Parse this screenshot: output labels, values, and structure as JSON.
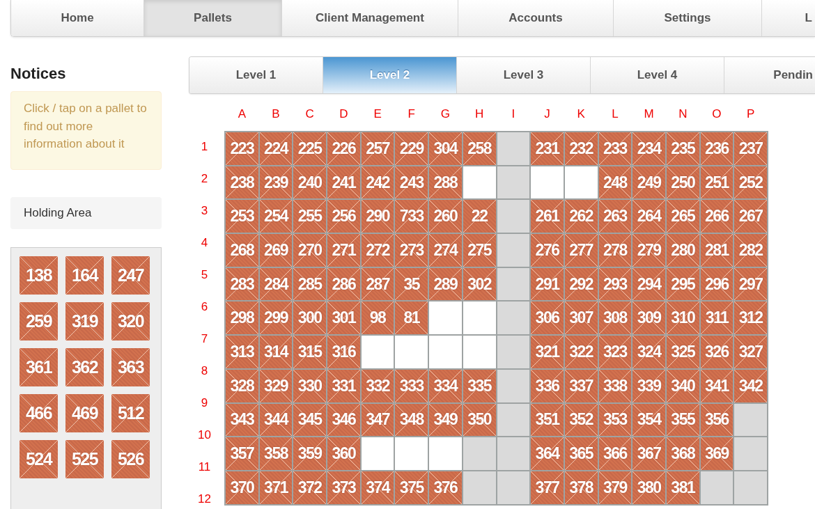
{
  "nav": [
    {
      "label": "Home",
      "selected": false
    },
    {
      "label": "Pallets",
      "selected": true
    },
    {
      "label": "Client Management",
      "selected": false
    },
    {
      "label": "Accounts",
      "selected": false
    },
    {
      "label": "Settings",
      "selected": false
    },
    {
      "label": "L",
      "selected": false
    }
  ],
  "sidebar": {
    "notices_title": "Notices",
    "notice": "Click / tap on a pallet to find out more information about it",
    "holding_area": {
      "title": "Holding Area",
      "pallets": [
        "138",
        "164",
        "247",
        "259",
        "319",
        "320",
        "361",
        "362",
        "363",
        "466",
        "469",
        "512",
        "524",
        "525",
        "526"
      ]
    }
  },
  "levels": [
    {
      "label": "Level 1",
      "selected": false
    },
    {
      "label": "Level 2",
      "selected": true
    },
    {
      "label": "Level 3",
      "selected": false
    },
    {
      "label": "Level 4",
      "selected": false
    },
    {
      "label": "Pendin",
      "selected": false
    }
  ],
  "floor": {
    "columns": [
      "A",
      "B",
      "C",
      "D",
      "E",
      "F",
      "G",
      "H",
      "I",
      "J",
      "K",
      "L",
      "M",
      "N",
      "O",
      "P"
    ],
    "row_labels": [
      "1",
      "2",
      "3",
      "4",
      "5",
      "6",
      "7",
      "8",
      "9",
      "10",
      "11",
      "12"
    ],
    "rows": [
      [
        {
          "kind": "pallet",
          "label": "223"
        },
        {
          "kind": "pallet",
          "label": "224"
        },
        {
          "kind": "pallet",
          "label": "225"
        },
        {
          "kind": "pallet",
          "label": "226"
        },
        {
          "kind": "pallet",
          "label": "257"
        },
        {
          "kind": "pallet",
          "label": "229"
        },
        {
          "kind": "pallet",
          "label": "304"
        },
        {
          "kind": "pallet",
          "label": "258"
        },
        {
          "kind": "aisle"
        },
        {
          "kind": "pallet",
          "label": "231"
        },
        {
          "kind": "pallet",
          "label": "232"
        },
        {
          "kind": "pallet",
          "label": "233"
        },
        {
          "kind": "pallet",
          "label": "234"
        },
        {
          "kind": "pallet",
          "label": "235"
        },
        {
          "kind": "pallet",
          "label": "236"
        },
        {
          "kind": "pallet",
          "label": "237"
        }
      ],
      [
        {
          "kind": "pallet",
          "label": "238"
        },
        {
          "kind": "pallet",
          "label": "239"
        },
        {
          "kind": "pallet",
          "label": "240"
        },
        {
          "kind": "pallet",
          "label": "241"
        },
        {
          "kind": "pallet",
          "label": "242"
        },
        {
          "kind": "pallet",
          "label": "243"
        },
        {
          "kind": "pallet",
          "label": "288"
        },
        {
          "kind": "empty"
        },
        {
          "kind": "aisle"
        },
        {
          "kind": "empty"
        },
        {
          "kind": "empty"
        },
        {
          "kind": "pallet",
          "label": "248"
        },
        {
          "kind": "pallet",
          "label": "249"
        },
        {
          "kind": "pallet",
          "label": "250"
        },
        {
          "kind": "pallet",
          "label": "251"
        },
        {
          "kind": "pallet",
          "label": "252"
        }
      ],
      [
        {
          "kind": "pallet",
          "label": "253"
        },
        {
          "kind": "pallet",
          "label": "254"
        },
        {
          "kind": "pallet",
          "label": "255"
        },
        {
          "kind": "pallet",
          "label": "256"
        },
        {
          "kind": "pallet",
          "label": "290"
        },
        {
          "kind": "pallet",
          "label": "733"
        },
        {
          "kind": "pallet",
          "label": "260"
        },
        {
          "kind": "pallet",
          "label": "22"
        },
        {
          "kind": "aisle"
        },
        {
          "kind": "pallet",
          "label": "261"
        },
        {
          "kind": "pallet",
          "label": "262"
        },
        {
          "kind": "pallet",
          "label": "263"
        },
        {
          "kind": "pallet",
          "label": "264"
        },
        {
          "kind": "pallet",
          "label": "265"
        },
        {
          "kind": "pallet",
          "label": "266"
        },
        {
          "kind": "pallet",
          "label": "267"
        }
      ],
      [
        {
          "kind": "pallet",
          "label": "268"
        },
        {
          "kind": "pallet",
          "label": "269"
        },
        {
          "kind": "pallet",
          "label": "270"
        },
        {
          "kind": "pallet",
          "label": "271"
        },
        {
          "kind": "pallet",
          "label": "272"
        },
        {
          "kind": "pallet",
          "label": "273"
        },
        {
          "kind": "pallet",
          "label": "274"
        },
        {
          "kind": "pallet",
          "label": "275"
        },
        {
          "kind": "aisle"
        },
        {
          "kind": "pallet",
          "label": "276"
        },
        {
          "kind": "pallet",
          "label": "277"
        },
        {
          "kind": "pallet",
          "label": "278"
        },
        {
          "kind": "pallet",
          "label": "279"
        },
        {
          "kind": "pallet",
          "label": "280"
        },
        {
          "kind": "pallet",
          "label": "281"
        },
        {
          "kind": "pallet",
          "label": "282"
        }
      ],
      [
        {
          "kind": "pallet",
          "label": "283"
        },
        {
          "kind": "pallet",
          "label": "284"
        },
        {
          "kind": "pallet",
          "label": "285"
        },
        {
          "kind": "pallet",
          "label": "286"
        },
        {
          "kind": "pallet",
          "label": "287"
        },
        {
          "kind": "pallet",
          "label": "35"
        },
        {
          "kind": "pallet",
          "label": "289"
        },
        {
          "kind": "pallet",
          "label": "302"
        },
        {
          "kind": "aisle"
        },
        {
          "kind": "pallet",
          "label": "291"
        },
        {
          "kind": "pallet",
          "label": "292"
        },
        {
          "kind": "pallet",
          "label": "293"
        },
        {
          "kind": "pallet",
          "label": "294"
        },
        {
          "kind": "pallet",
          "label": "295"
        },
        {
          "kind": "pallet",
          "label": "296"
        },
        {
          "kind": "pallet",
          "label": "297"
        }
      ],
      [
        {
          "kind": "pallet",
          "label": "298"
        },
        {
          "kind": "pallet",
          "label": "299"
        },
        {
          "kind": "pallet",
          "label": "300"
        },
        {
          "kind": "pallet",
          "label": "301"
        },
        {
          "kind": "pallet",
          "label": "98"
        },
        {
          "kind": "pallet",
          "label": "81"
        },
        {
          "kind": "empty"
        },
        {
          "kind": "empty"
        },
        {
          "kind": "aisle"
        },
        {
          "kind": "pallet",
          "label": "306"
        },
        {
          "kind": "pallet",
          "label": "307"
        },
        {
          "kind": "pallet",
          "label": "308"
        },
        {
          "kind": "pallet",
          "label": "309"
        },
        {
          "kind": "pallet",
          "label": "310"
        },
        {
          "kind": "pallet",
          "label": "311"
        },
        {
          "kind": "pallet",
          "label": "312"
        }
      ],
      [
        {
          "kind": "pallet",
          "label": "313"
        },
        {
          "kind": "pallet",
          "label": "314"
        },
        {
          "kind": "pallet",
          "label": "315"
        },
        {
          "kind": "pallet",
          "label": "316"
        },
        {
          "kind": "empty"
        },
        {
          "kind": "empty"
        },
        {
          "kind": "empty"
        },
        {
          "kind": "empty"
        },
        {
          "kind": "aisle"
        },
        {
          "kind": "pallet",
          "label": "321"
        },
        {
          "kind": "pallet",
          "label": "322"
        },
        {
          "kind": "pallet",
          "label": "323"
        },
        {
          "kind": "pallet",
          "label": "324"
        },
        {
          "kind": "pallet",
          "label": "325"
        },
        {
          "kind": "pallet",
          "label": "326"
        },
        {
          "kind": "pallet",
          "label": "327"
        }
      ],
      [
        {
          "kind": "pallet",
          "label": "328"
        },
        {
          "kind": "pallet",
          "label": "329"
        },
        {
          "kind": "pallet",
          "label": "330"
        },
        {
          "kind": "pallet",
          "label": "331"
        },
        {
          "kind": "pallet",
          "label": "332"
        },
        {
          "kind": "pallet",
          "label": "333"
        },
        {
          "kind": "pallet",
          "label": "334"
        },
        {
          "kind": "pallet",
          "label": "335"
        },
        {
          "kind": "aisle"
        },
        {
          "kind": "pallet",
          "label": "336"
        },
        {
          "kind": "pallet",
          "label": "337"
        },
        {
          "kind": "pallet",
          "label": "338"
        },
        {
          "kind": "pallet",
          "label": "339"
        },
        {
          "kind": "pallet",
          "label": "340"
        },
        {
          "kind": "pallet",
          "label": "341"
        },
        {
          "kind": "pallet",
          "label": "342"
        }
      ],
      [
        {
          "kind": "pallet",
          "label": "343"
        },
        {
          "kind": "pallet",
          "label": "344"
        },
        {
          "kind": "pallet",
          "label": "345"
        },
        {
          "kind": "pallet",
          "label": "346"
        },
        {
          "kind": "pallet",
          "label": "347"
        },
        {
          "kind": "pallet",
          "label": "348"
        },
        {
          "kind": "pallet",
          "label": "349"
        },
        {
          "kind": "pallet",
          "label": "350"
        },
        {
          "kind": "aisle"
        },
        {
          "kind": "pallet",
          "label": "351"
        },
        {
          "kind": "pallet",
          "label": "352"
        },
        {
          "kind": "pallet",
          "label": "353"
        },
        {
          "kind": "pallet",
          "label": "354"
        },
        {
          "kind": "pallet",
          "label": "355"
        },
        {
          "kind": "pallet",
          "label": "356"
        },
        {
          "kind": "aisle"
        }
      ],
      [
        {
          "kind": "pallet",
          "label": "357"
        },
        {
          "kind": "pallet",
          "label": "358"
        },
        {
          "kind": "pallet",
          "label": "359"
        },
        {
          "kind": "pallet",
          "label": "360"
        },
        {
          "kind": "empty"
        },
        {
          "kind": "empty"
        },
        {
          "kind": "empty"
        },
        {
          "kind": "aisle"
        },
        {
          "kind": "aisle"
        },
        {
          "kind": "pallet",
          "label": "364"
        },
        {
          "kind": "pallet",
          "label": "365"
        },
        {
          "kind": "pallet",
          "label": "366"
        },
        {
          "kind": "pallet",
          "label": "367"
        },
        {
          "kind": "pallet",
          "label": "368"
        },
        {
          "kind": "pallet",
          "label": "369"
        },
        {
          "kind": "aisle"
        }
      ],
      [
        {
          "kind": "pallet",
          "label": "370"
        },
        {
          "kind": "pallet",
          "label": "371"
        },
        {
          "kind": "pallet",
          "label": "372"
        },
        {
          "kind": "pallet",
          "label": "373"
        },
        {
          "kind": "pallet",
          "label": "374"
        },
        {
          "kind": "pallet",
          "label": "375"
        },
        {
          "kind": "pallet",
          "label": "376"
        },
        {
          "kind": "aisle"
        },
        {
          "kind": "aisle"
        },
        {
          "kind": "pallet",
          "label": "377"
        },
        {
          "kind": "pallet",
          "label": "378"
        },
        {
          "kind": "pallet",
          "label": "379"
        },
        {
          "kind": "pallet",
          "label": "380"
        },
        {
          "kind": "pallet",
          "label": "381"
        },
        {
          "kind": "aisle"
        },
        {
          "kind": "aisle"
        }
      ]
    ]
  }
}
